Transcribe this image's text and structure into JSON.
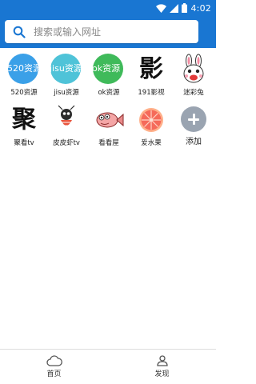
{
  "status_bar": {
    "time": "4:02",
    "icons": [
      "wifi-icon",
      "signal-icon",
      "battery-icon"
    ]
  },
  "search": {
    "placeholder": "搜索或输入网址",
    "icon": "search-icon"
  },
  "tiles": [
    {
      "label": "520资源",
      "icon_text": "520资源",
      "color": "#3aa0e8"
    },
    {
      "label": "jisu资源",
      "icon_text": "jisu资源",
      "color": "#4fc3d8"
    },
    {
      "label": "ok资源",
      "icon_text": "ok资源",
      "color": "#3fba5a"
    },
    {
      "label": "191影视",
      "icon_text": "影",
      "icon": "calligraphy-ying-icon"
    },
    {
      "label": "迷彩兔",
      "icon": "rabbit-icon"
    },
    {
      "label": "聚看tv",
      "icon_text": "聚",
      "icon": "calligraphy-ju-icon"
    },
    {
      "label": "皮皮虾tv",
      "icon": "shrimp-icon"
    },
    {
      "label": "看看屋",
      "icon": "fish-icon"
    },
    {
      "label": "爱水果",
      "icon": "grapefruit-icon"
    },
    {
      "label": "添加",
      "icon": "add-icon"
    }
  ],
  "bottom_nav": [
    {
      "label": "首页",
      "icon": "cloud-icon"
    },
    {
      "label": "发现",
      "icon": "person-icon"
    }
  ],
  "colors": {
    "primary": "#1976d2",
    "background": "#ffffff",
    "add_button": "#9aa4b1"
  }
}
